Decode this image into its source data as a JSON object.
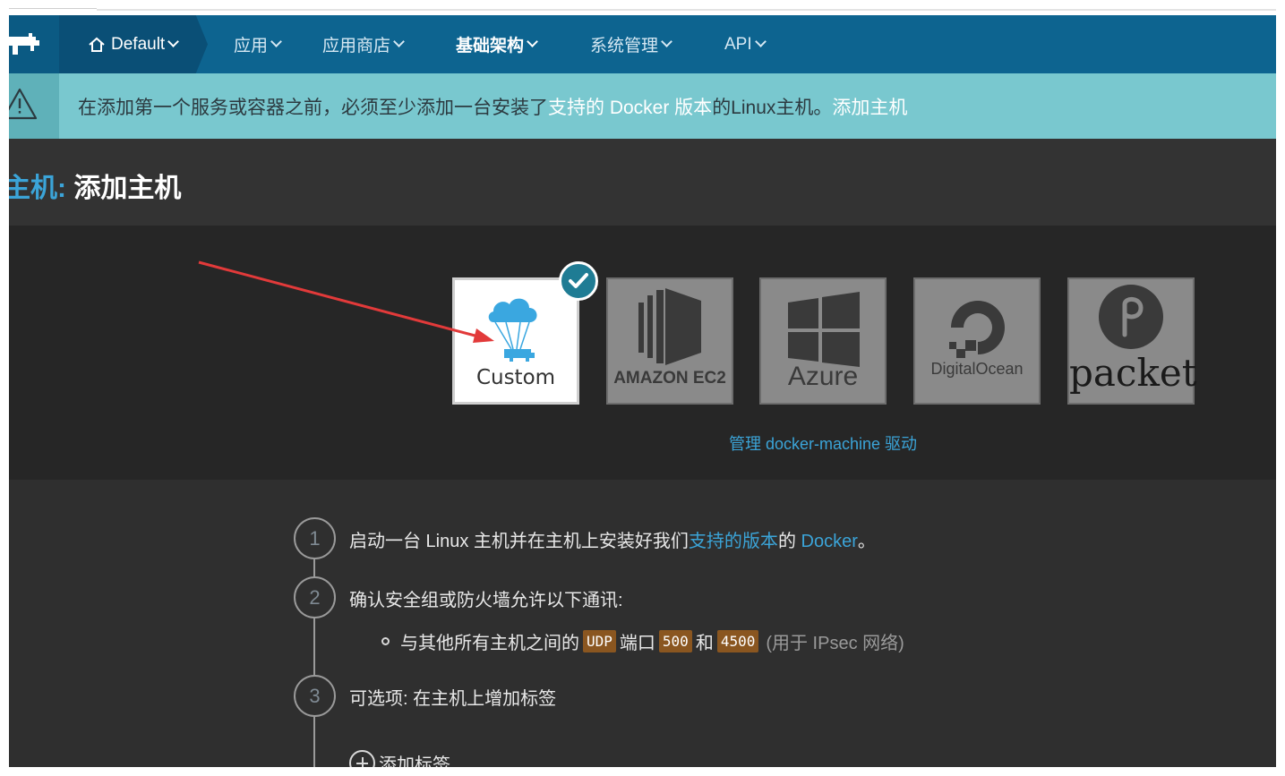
{
  "nav": {
    "environment": "Default",
    "items": [
      {
        "label": "应用"
      },
      {
        "label": "应用商店"
      },
      {
        "label": "基础架构"
      },
      {
        "label": "系统管理"
      },
      {
        "label": "API"
      }
    ]
  },
  "alert": {
    "text_before": "在添加第一个服务或容器之前，必须至少添加一台安装了",
    "link_docker": "支持的 Docker 版本",
    "text_after": " 的Linux主机。",
    "link_add_host": "添加主机"
  },
  "header": {
    "crumb": "主机:",
    "title": "添加主机"
  },
  "drivers": [
    {
      "label": "Custom",
      "selected": true
    },
    {
      "label": "AMAZON EC2",
      "selected": false
    },
    {
      "label": "Azure",
      "selected": false
    },
    {
      "label": "DigitalOcean",
      "selected": false
    },
    {
      "label": "packet",
      "selected": false
    }
  ],
  "manage_drivers_link": "管理 docker-machine 驱动",
  "steps": [
    {
      "num": "1",
      "text_before": "启动一台 Linux 主机并在主机上安装好我们",
      "link_versions": "支持的版本",
      "text_mid": "的 ",
      "link_docker": "Docker",
      "text_end": "。"
    },
    {
      "num": "2",
      "text": "确认安全组或防火墙允许以下通讯:",
      "sub_text_before": "与其他所有主机之间的",
      "code_udp": "UDP",
      "sub_port": "端口",
      "code_500": "500",
      "sub_and": "和",
      "code_4500": "4500",
      "sub_note": "(用于 IPsec 网络)"
    },
    {
      "num": "3",
      "text": "可选项: 在主机上增加标签"
    }
  ],
  "add_tag_label": "添加标签"
}
